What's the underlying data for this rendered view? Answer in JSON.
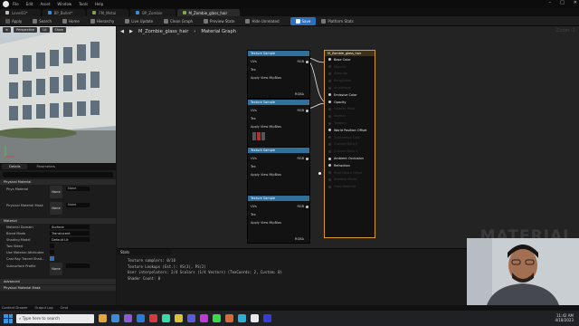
{
  "menu": [
    "File",
    "Edit",
    "Asset",
    "Window",
    "Tools",
    "Help"
  ],
  "dock_tabs": [
    {
      "label": "Level03*",
      "color": "#c0c0c0",
      "active": false
    },
    {
      "label": "BP_Bullet*",
      "color": "#3a8bd8",
      "active": false
    },
    {
      "label": "FM_Metal",
      "color": "#78a84a",
      "active": false
    },
    {
      "label": "BP_Zombie",
      "color": "#3a8bd8",
      "active": false
    },
    {
      "label": "M_Zombie_glass_hair",
      "color": "#78a84a",
      "active": true
    }
  ],
  "toolbar": [
    {
      "label": "Apply",
      "color": "#555"
    },
    {
      "label": "Search",
      "color": "#777"
    },
    {
      "label": "Home",
      "color": "#777"
    },
    {
      "label": "Hierarchy",
      "color": "#777"
    },
    {
      "label": "Live Update",
      "color": "#777"
    },
    {
      "label": "Clean Graph",
      "color": "#777"
    },
    {
      "label": "Preview State",
      "color": "#777"
    },
    {
      "label": "Hide Unrelated",
      "color": "#777"
    }
  ],
  "toolbar_primary": "Save",
  "toolbar_last": "Platform Stats",
  "viewport": {
    "buttons": [
      "Perspective",
      "Lit",
      "Show"
    ]
  },
  "details": {
    "tabs": [
      "Details",
      "Parameters"
    ],
    "sections": [
      {
        "title": "Physical Material",
        "rows": [
          {
            "label": "Phys Material",
            "value": "None",
            "thumb": "None"
          },
          {
            "label": "Physical Material Mask",
            "value": "None",
            "thumb": "None"
          }
        ]
      },
      {
        "title": "Material",
        "rows": [
          {
            "label": "Material Domain",
            "value": "Surface"
          },
          {
            "label": "Blend Mode",
            "value": "Translucent"
          },
          {
            "label": "Shading Model",
            "value": "Default Lit"
          },
          {
            "label": "Two Sided",
            "value": ""
          },
          {
            "label": "Use Material Attributes",
            "value": ""
          },
          {
            "label": "Cast Ray Traced Shad...",
            "value": ""
          },
          {
            "label": "Subsurface Profile",
            "value": "None",
            "thumb": "None"
          }
        ]
      }
    ],
    "footer_sections": [
      "Advanced",
      "Physical Material Mask"
    ]
  },
  "graph": {
    "breadcrumb": "M_Zombie_glass_hair",
    "sep": "›",
    "title": "Material Graph",
    "zoom": "Zoom -1",
    "watermark": "MATERIAL"
  },
  "texture_node": {
    "title": "Texture Sample",
    "uvs": "UVs",
    "tex": "Tex",
    "mip": "Apply View MipBias",
    "outs": [
      "RGB",
      "R",
      "G",
      "B",
      "A",
      "RGBA"
    ]
  },
  "main_node": {
    "title": "M_Zombie_glass_hair",
    "inputs": [
      {
        "label": "Base Color",
        "on": true
      },
      {
        "label": "Metallic",
        "on": false
      },
      {
        "label": "Specular",
        "on": false
      },
      {
        "label": "Roughness",
        "on": false
      },
      {
        "label": "Anisotropy",
        "on": false
      },
      {
        "label": "Emissive Color",
        "on": true
      },
      {
        "label": "Opacity",
        "on": true
      },
      {
        "label": "Opacity Mask",
        "on": false
      },
      {
        "label": "Normal",
        "on": false
      },
      {
        "label": "Tangent",
        "on": false
      },
      {
        "label": "World Position Offset",
        "on": true
      },
      {
        "label": "Subsurface Color",
        "on": false
      },
      {
        "label": "Custom Data 0",
        "on": false
      },
      {
        "label": "Custom Data 1",
        "on": false
      },
      {
        "label": "Ambient Occlusion",
        "on": true
      },
      {
        "label": "Refraction",
        "on": true
      },
      {
        "label": "Pixel Depth Offset",
        "on": false
      },
      {
        "label": "Shading Model",
        "on": false
      },
      {
        "label": "Front Material",
        "on": false
      }
    ]
  },
  "stats": {
    "tab": "Stats",
    "lines": [
      "Texture samplers: 0/16",
      "Texture Lookups (Est.): VS(3), PS(2)",
      "User interpolators: 2/4 Scalars (1/4 Vectors) (TexCoords: 2, Custom: 0)",
      "Shader Count: 0"
    ]
  },
  "statusbar": [
    "Content Drawer",
    "Output Log",
    "Cmd"
  ],
  "taskbar": {
    "search_placeholder": "Type here to search",
    "apps": [
      "#e8a33a",
      "#3a8bd8",
      "#8a5bd8",
      "#2b7ad8",
      "#d83a3a",
      "#3ad8a5",
      "#d8c43a",
      "#5a5adb",
      "#c03ad8",
      "#3ad84a",
      "#d86a3a",
      "#2bb0d8",
      "#e8e8e8",
      "#3a3ad8"
    ],
    "time": "11:42 AM",
    "date": "4/18/2023"
  },
  "colors": {
    "accent": "#2c6fbf",
    "node_header": "#30709a",
    "main_border": "#d69b2c"
  }
}
